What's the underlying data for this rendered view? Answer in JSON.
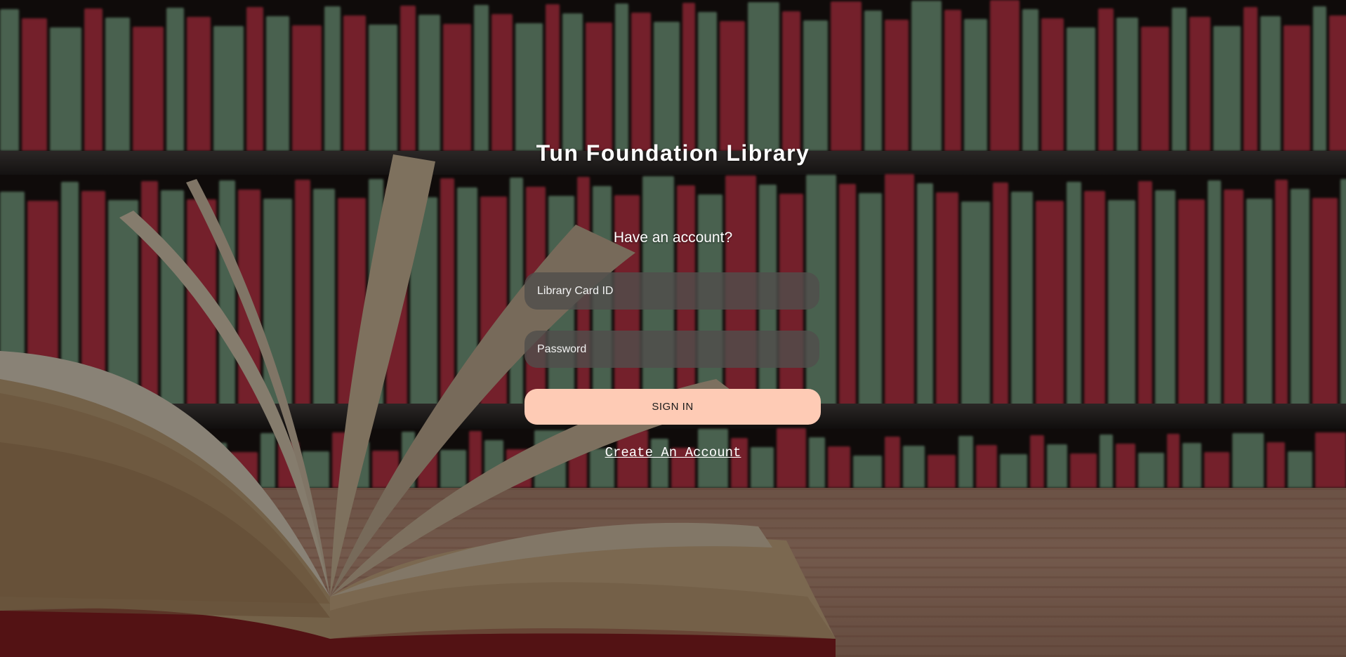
{
  "brand": {
    "title": "Tun Foundation Library"
  },
  "login": {
    "heading": "Have an account?",
    "card_id_placeholder": "Library Card ID",
    "password_placeholder": "Password",
    "signin_label": "SIGN IN",
    "create_account_label": "Create An Account"
  },
  "colors": {
    "signin_button": "#fecbb5",
    "input_background": "#504e4c",
    "text": "#ffffff"
  }
}
